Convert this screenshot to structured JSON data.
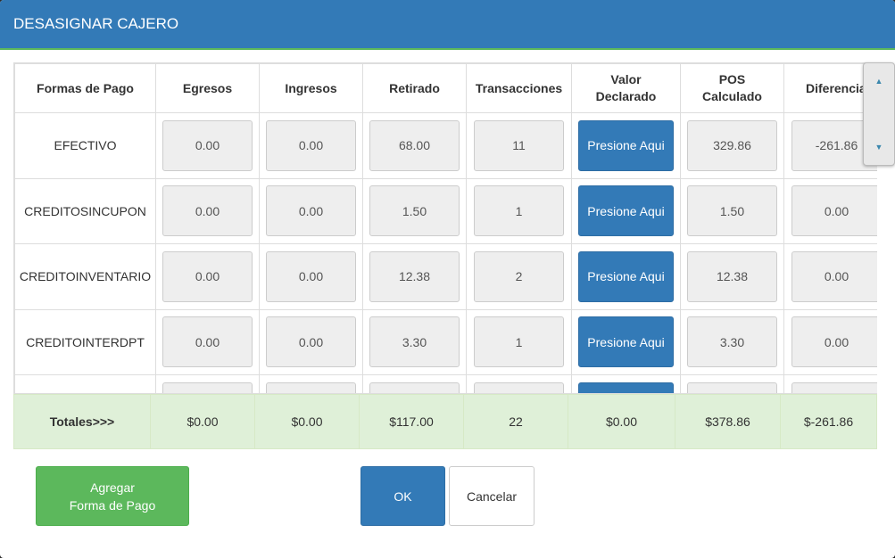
{
  "modal": {
    "title": "DESASIGNAR CAJERO"
  },
  "table": {
    "headers": [
      "Formas de Pago",
      "Egresos",
      "Ingresos",
      "Retirado",
      "Transacciones",
      "Valor Declarado",
      "POS Calculado",
      "Diferencia"
    ],
    "rows": [
      {
        "forma": "EFECTIVO",
        "egresos": "0.00",
        "ingresos": "0.00",
        "retirado": "68.00",
        "transacciones": "11",
        "valor": "Presione Aqui",
        "pos": "329.86",
        "diferencia": "-261.86"
      },
      {
        "forma": "CREDITOSINCUPON",
        "egresos": "0.00",
        "ingresos": "0.00",
        "retirado": "1.50",
        "transacciones": "1",
        "valor": "Presione Aqui",
        "pos": "1.50",
        "diferencia": "0.00"
      },
      {
        "forma": "CREDITOINVENTARIO",
        "egresos": "0.00",
        "ingresos": "0.00",
        "retirado": "12.38",
        "transacciones": "2",
        "valor": "Presione Aqui",
        "pos": "12.38",
        "diferencia": "0.00"
      },
      {
        "forma": "CREDITOINTERDPT",
        "egresos": "0.00",
        "ingresos": "0.00",
        "retirado": "3.30",
        "transacciones": "1",
        "valor": "Presione Aqui",
        "pos": "3.30",
        "diferencia": "0.00"
      }
    ]
  },
  "totals": {
    "label": "Totales>>>",
    "egresos": "$0.00",
    "ingresos": "$0.00",
    "retirado": "$117.00",
    "transacciones": "22",
    "valor": "$0.00",
    "pos": "$378.86",
    "diferencia": "$-261.86"
  },
  "buttons": {
    "agregar_line1": "Agregar",
    "agregar_line2": "Forma de Pago",
    "ok": "OK",
    "cancelar": "Cancelar"
  },
  "scroll": {
    "up_icon": "▲",
    "down_icon": "▼"
  },
  "colors": {
    "header": "#337ab7",
    "accent_green": "#5cb85c",
    "totals_bg": "#dff0d8",
    "primary": "#337ab7"
  }
}
